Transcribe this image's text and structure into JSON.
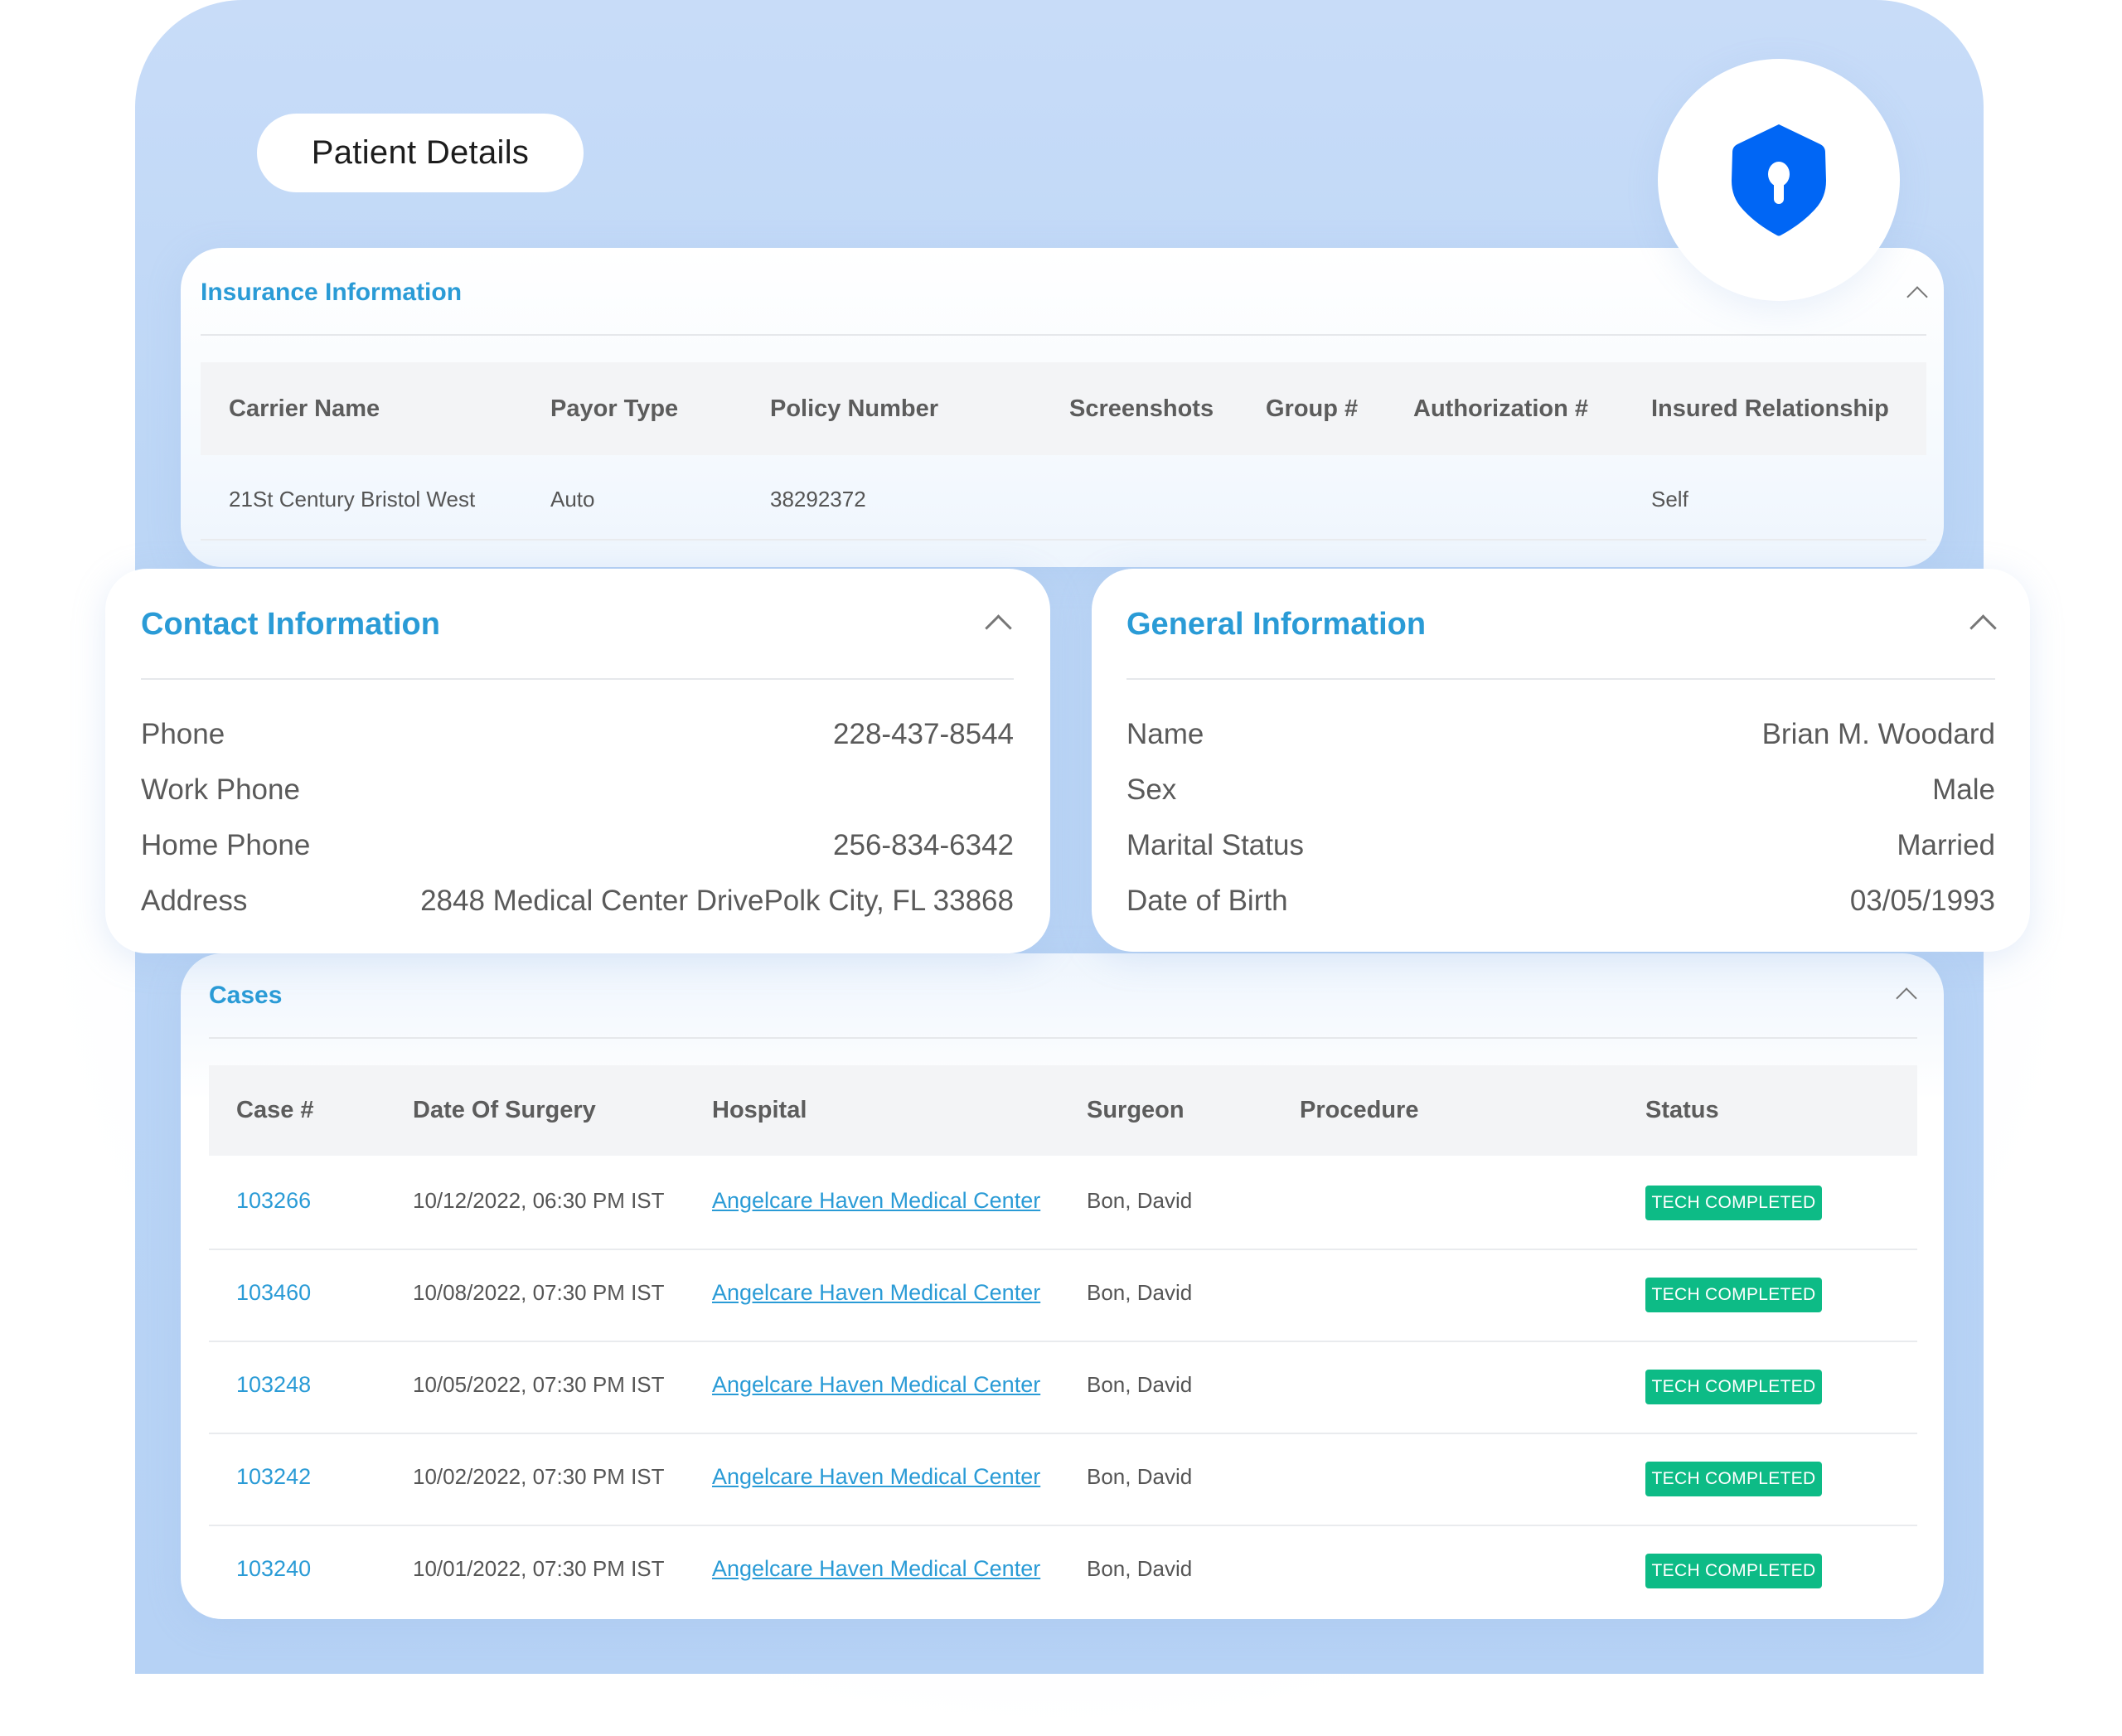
{
  "page": {
    "title": "Patient Details",
    "icon": "shield-lock-icon",
    "colors": {
      "accent": "#2a9bd6",
      "shield": "#0066f5",
      "badge_success": "#0dbb86",
      "panel_bg": "#bcd6f6"
    }
  },
  "insurance": {
    "title": "Insurance Information",
    "columns": [
      "Carrier Name",
      "Payor Type",
      "Policy Number",
      "Screenshots",
      "Group #",
      "Authorization #",
      "Insured Relationship"
    ],
    "rows": [
      [
        "21St Century Bristol West",
        "Auto",
        "38292372",
        "",
        "",
        "",
        "Self"
      ]
    ]
  },
  "contact": {
    "title": "Contact Information",
    "fields": [
      {
        "label": "Phone",
        "value": "228-437-8544"
      },
      {
        "label": "Work Phone",
        "value": ""
      },
      {
        "label": "Home Phone",
        "value": "256-834-6342"
      },
      {
        "label": "Address",
        "value": "2848 Medical Center DrivePolk City, FL 33868"
      }
    ]
  },
  "general": {
    "title": "General Information",
    "fields": [
      {
        "label": "Name",
        "value": "Brian M. Woodard"
      },
      {
        "label": "Sex",
        "value": "Male"
      },
      {
        "label": "Marital Status",
        "value": "Married"
      },
      {
        "label": "Date of Birth",
        "value": "03/05/1993"
      }
    ]
  },
  "cases": {
    "title": "Cases",
    "columns": [
      "Case #",
      "Date Of Surgery",
      "Hospital",
      "Surgeon",
      "Procedure",
      "Status"
    ],
    "rows": [
      {
        "case": "103266",
        "date": "10/12/2022, 06:30 PM IST",
        "hospital": "Angelcare Haven Medical Center",
        "surgeon": "Bon, David",
        "procedure": "",
        "status": "TECH COMPLETED"
      },
      {
        "case": "103460",
        "date": "10/08/2022, 07:30 PM IST",
        "hospital": "Angelcare Haven Medical Center",
        "surgeon": "Bon, David",
        "procedure": "",
        "status": "TECH COMPLETED"
      },
      {
        "case": "103248",
        "date": "10/05/2022, 07:30 PM IST",
        "hospital": "Angelcare Haven Medical Center",
        "surgeon": "Bon, David",
        "procedure": "",
        "status": "TECH COMPLETED"
      },
      {
        "case": "103242",
        "date": "10/02/2022, 07:30 PM IST",
        "hospital": "Angelcare Haven Medical Center",
        "surgeon": "Bon, David",
        "procedure": "",
        "status": "TECH COMPLETED"
      },
      {
        "case": "103240",
        "date": "10/01/2022, 07:30 PM IST",
        "hospital": "Angelcare Haven Medical Center",
        "surgeon": "Bon, David",
        "procedure": "",
        "status": "TECH COMPLETED"
      }
    ]
  }
}
